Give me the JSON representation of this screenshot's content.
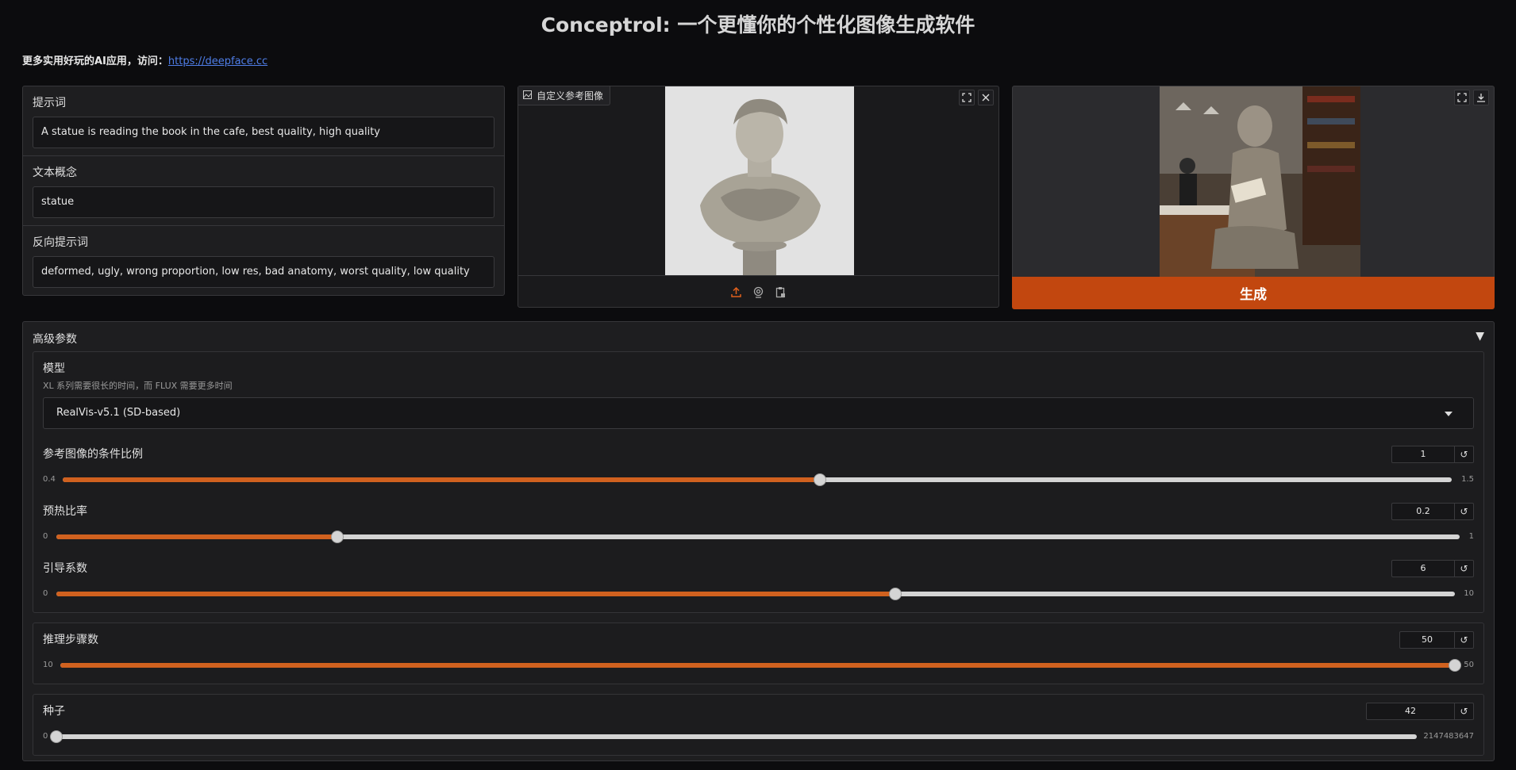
{
  "page": {
    "title": "Conceptrol: 一个更懂你的个性化图像生成软件",
    "subline_text": "更多实用好玩的AI应用，访问：",
    "subline_link": "https://deepface.cc"
  },
  "prompts": [
    {
      "label": "提示词",
      "value": "A statue is reading the book in the cafe, best quality, high quality"
    },
    {
      "label": "文本概念",
      "value": "statue"
    },
    {
      "label": "反向提示词",
      "value": "deformed, ugly, wrong proportion, low res, bad anatomy, worst quality, low quality"
    }
  ],
  "reference": {
    "label": "自定义参考图像",
    "toolbar_icons": [
      "upload-icon",
      "webcam-icon",
      "clipboard-icon"
    ],
    "upload_color": "#e0601d"
  },
  "output": {
    "generate_label": "生成",
    "accent": "#c2470f"
  },
  "advanced": {
    "title": "高级参数",
    "toggle": "▼",
    "model": {
      "label": "模型",
      "info": "XL 系列需要很长的时间，而 FLUX 需要更多时间",
      "selected": "RealVis-v5.1 (SD-based)"
    },
    "sliders": [
      {
        "label": "参考图像的条件比例",
        "value": "1",
        "min": "0.4",
        "max": "1.5",
        "fraction": 0.545
      },
      {
        "label": "预热比率",
        "value": "0.2",
        "min": "0",
        "max": "1",
        "fraction": 0.2
      },
      {
        "label": "引导系数",
        "value": "6",
        "min": "0",
        "max": "10",
        "fraction": 0.6
      },
      {
        "label": "推理步骤数",
        "value": "50",
        "min": "10",
        "max": "50",
        "fraction": 1.0
      },
      {
        "label": "种子",
        "value": "42",
        "min": "0",
        "max": "2147483647",
        "fraction": 0.0
      }
    ],
    "reset_glyph": "↺"
  }
}
